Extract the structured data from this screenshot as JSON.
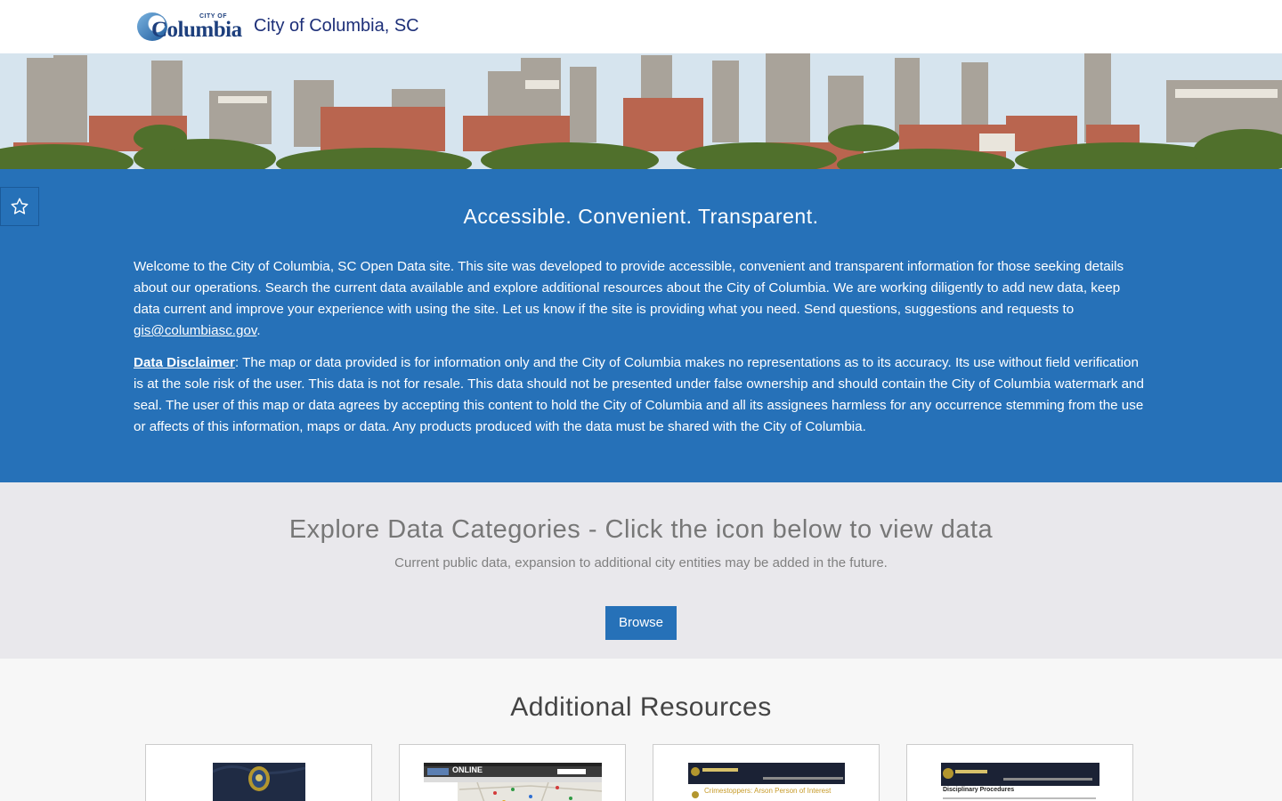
{
  "header": {
    "logo_top": "CITY OF",
    "logo_word": "Columbia",
    "site_title": "City of Columbia, SC"
  },
  "intro": {
    "heading": "Accessible. Convenient. Transparent.",
    "welcome_text": "Welcome to the City of Columbia, SC Open Data site. This site was developed to provide accessible, convenient and transparent information for those seeking details about our operations. Search the current data available and explore additional resources about the City of Columbia. We are working diligently to add new data, keep data current and improve your experience with using the site. Let us know if the site is providing what you need. Send questions, suggestions and requests to ",
    "email": "gis@columbiasc.gov",
    "welcome_end": ".",
    "disclaimer_label": "Data Disclaimer",
    "disclaimer_text": ": The map or data provided is for information only and the City of Columbia makes no representations as to its accuracy. Its use without field verification is at the sole risk of the user. This data is not for resale. This data should not be presented under false ownership and should contain the City of Columbia watermark and seal. The user of this map or data agrees by accepting this content to hold the City of Columbia and all its assignees harmless for any occurrence stemming from the use or affects of this information, maps or data. Any products produced with the data must be shared with the City of Columbia."
  },
  "explore": {
    "heading": "Explore Data Categories - Click the icon below to view data",
    "subtitle": "Current public data, expansion to additional city entities may be added in the future.",
    "browse_label": "Browse"
  },
  "resources": {
    "heading": "Additional Resources",
    "cards": [
      {
        "thumb_icon": "police-patch-icon"
      },
      {
        "thumb_icon": "crime-map-icon",
        "thumb_text": "ONLINE"
      },
      {
        "thumb_icon": "police-webpage-icon",
        "thumb_text": "Crimestoppers: Arson Person of Interest"
      },
      {
        "thumb_icon": "police-webpage-icon",
        "thumb_text": "Disciplinary Procedures"
      }
    ]
  },
  "colors": {
    "primary_blue": "#2671b8",
    "title_navy": "#1d2f78",
    "explore_bg": "#e9e8ec",
    "page_bg": "#f7f7f7"
  }
}
